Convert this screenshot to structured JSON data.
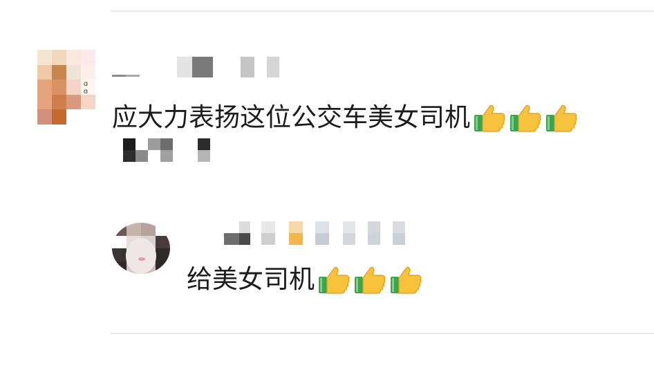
{
  "comments": [
    {
      "text": "应大力表扬这位公交车美女司机",
      "reaction_count": 3,
      "reaction_icon": "thumbs-up-icon"
    },
    {
      "text": "给美女司机",
      "reaction_count": 3,
      "reaction_icon": "thumbs-up-icon"
    }
  ],
  "colors": {
    "thumb_yellow": "#f8c23a",
    "thumb_green": "#3aa64a",
    "divider": "#e9e9e9"
  }
}
